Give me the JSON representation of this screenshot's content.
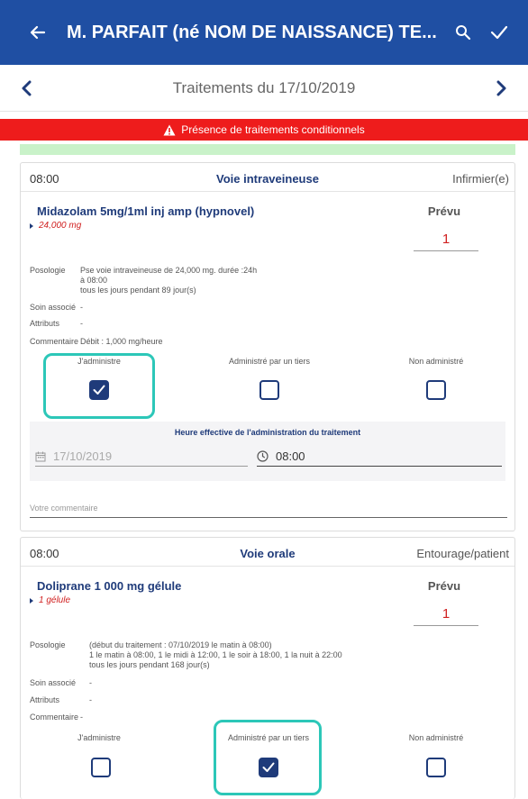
{
  "appbar": {
    "title": "M. PARFAIT (né NOM DE NAISSANCE) TE...",
    "back_icon": "arrow-left-icon",
    "search_icon": "search-icon",
    "validate_icon": "check-icon"
  },
  "datebar": {
    "title": "Traitements du 17/10/2019",
    "prev_icon": "chevron-left-icon",
    "next_icon": "chevron-right-icon"
  },
  "alert": {
    "text": "Présence de traitements conditionnels",
    "icon": "warning-icon"
  },
  "colors": {
    "appbar": "#1f4fa3",
    "alert": "#ee1c1c",
    "green_strip": "#c9f2c9",
    "highlight": "#2cc7b8",
    "checkbox": "#1f3b7a"
  },
  "treatments": [
    {
      "time": "08:00",
      "route": "Voie intraveineuse",
      "role": "Infirmier(e)",
      "drug": "Midazolam 5mg/1ml inj amp (hypnovel)",
      "dose": "24,000 mg",
      "prevu_label": "Prévu",
      "prevu_value": "1",
      "fields": [
        {
          "label": "Posologie",
          "lines": [
            "Pse voie intraveineuse de 24,000 mg. durée :24h",
            "à 08:00",
            "tous les jours pendant 89 jour(s)"
          ]
        },
        {
          "label": "Soin associé",
          "lines": [
            "-"
          ]
        },
        {
          "label": "Attributs",
          "lines": [
            "-"
          ]
        },
        {
          "label": "Commentaire",
          "lines": [
            "Débit : 1,000 mg/heure"
          ]
        }
      ],
      "options": [
        {
          "label": "J'administre",
          "checked": true
        },
        {
          "label": "Administré par un tiers",
          "checked": false
        },
        {
          "label": "Non administré",
          "checked": false
        }
      ],
      "admin_time": {
        "heading": "Heure effective de l'administration du traitement",
        "date": "17/10/2019",
        "time": "08:00"
      },
      "comment_placeholder": "Votre commentaire"
    },
    {
      "time": "08:00",
      "route": "Voie orale",
      "role": "Entourage/patient",
      "drug": "Doliprane 1 000 mg gélule",
      "dose": "1 gélule",
      "prevu_label": "Prévu",
      "prevu_value": "1",
      "fields": [
        {
          "label": "Posologie",
          "lines": [
            "(début du traitement : 07/10/2019 le matin à 08:00)",
            "1 le matin à 08:00, 1 le midi à 12:00, 1 le soir à 18:00, 1 la nuit à 22:00",
            "tous les jours pendant 168 jour(s)"
          ]
        },
        {
          "label": "Soin associé",
          "lines": [
            "-"
          ]
        },
        {
          "label": "Attributs",
          "lines": [
            "-"
          ]
        },
        {
          "label": "Commentaire",
          "lines": [
            "-"
          ]
        }
      ],
      "options": [
        {
          "label": "J'administre",
          "checked": false
        },
        {
          "label": "Administré par un tiers",
          "checked": true
        },
        {
          "label": "Non administré",
          "checked": false
        }
      ]
    }
  ]
}
